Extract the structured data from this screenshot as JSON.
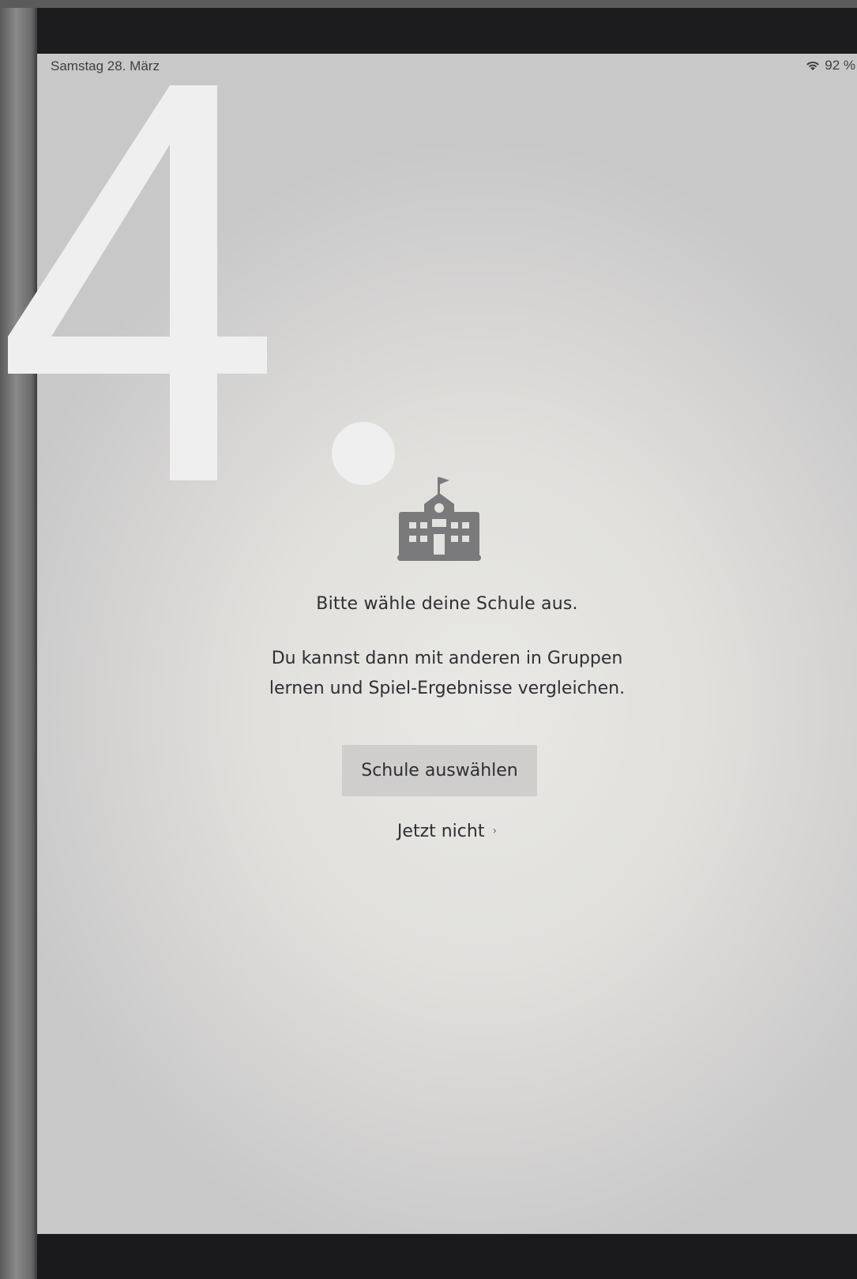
{
  "overlay": {
    "step_number": "4."
  },
  "status_bar": {
    "date": "Samstag 28. März",
    "battery": "92 %",
    "wifi_icon": "wifi-icon"
  },
  "main": {
    "icon": "school-building-icon",
    "title": "Bitte wähle deine Schule aus.",
    "description_lines": [
      "Du kannst dann mit anderen in Gruppen",
      "lernen und Spiel-Ergebnisse vergleichen."
    ],
    "primary_button_label": "Schule auswählen",
    "secondary_link_label": "Jetzt nicht",
    "secondary_link_icon": "chevron-right-icon"
  },
  "colors": {
    "text": "#2f2f33",
    "button_bg": "#cfcecc",
    "icon": "#7a7a7c",
    "overlay": "#efefef"
  }
}
